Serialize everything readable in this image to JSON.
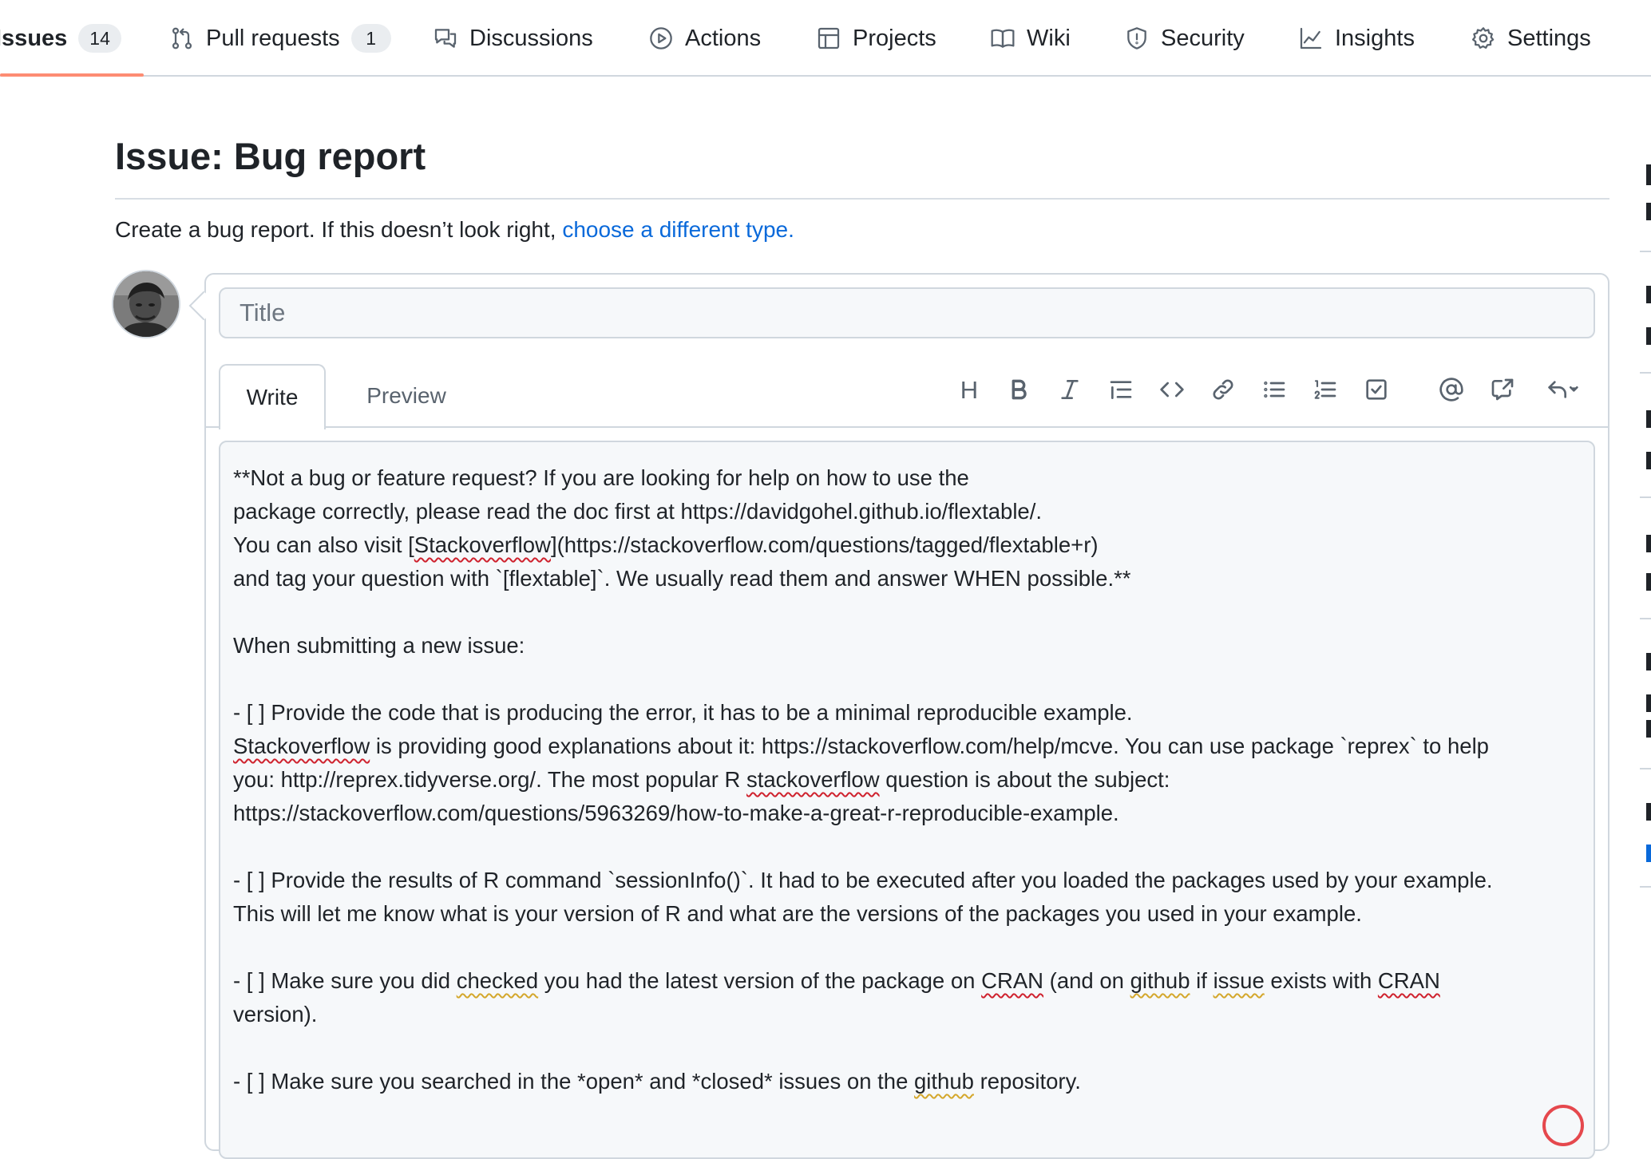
{
  "repo_nav": [
    {
      "label": "Issues",
      "count": "14",
      "icon": "issue-icon",
      "selected": true
    },
    {
      "label": "Pull requests",
      "count": "1",
      "icon": "pull-request-icon"
    },
    {
      "label": "Discussions",
      "icon": "comment-discussion-icon"
    },
    {
      "label": "Actions",
      "icon": "play-icon"
    },
    {
      "label": "Projects",
      "icon": "table-icon"
    },
    {
      "label": "Wiki",
      "icon": "book-icon"
    },
    {
      "label": "Security",
      "icon": "shield-icon"
    },
    {
      "label": "Insights",
      "icon": "graph-icon"
    },
    {
      "label": "Settings",
      "icon": "gear-icon"
    }
  ],
  "page": {
    "title": "Issue: Bug report",
    "subtitle_text": "Create a bug report. If this doesn’t look right,",
    "subtitle_link": "choose a different type."
  },
  "form": {
    "title_placeholder": "Title",
    "tabs": {
      "write": "Write",
      "preview": "Preview"
    },
    "toolbar": [
      {
        "name": "heading-button",
        "label": "H"
      },
      {
        "name": "bold-button",
        "icon": "bold-icon"
      },
      {
        "name": "italic-button",
        "icon": "italic-icon"
      },
      {
        "name": "quote-button",
        "icon": "quote-icon"
      },
      {
        "name": "code-button",
        "icon": "code-icon"
      },
      {
        "name": "link-button",
        "icon": "link-icon"
      },
      {
        "name": "unordered-list-button",
        "icon": "list-unordered-icon"
      },
      {
        "name": "ordered-list-button",
        "icon": "list-ordered-icon"
      },
      {
        "name": "task-list-button",
        "icon": "tasklist-icon"
      },
      {
        "name": "mention-button",
        "icon": "mention-icon"
      },
      {
        "name": "cross-reference-button",
        "icon": "cross-reference-icon"
      },
      {
        "name": "saved-replies-button",
        "icon": "reply-icon"
      }
    ],
    "body_lines": [
      "**Not a bug or feature request? If you are looking for help on how to use the",
      "package correctly, please read the doc first at https://davidgohel.github.io/flextable/.",
      "You can also visit [Stackoverflow](https://stackoverflow.com/questions/tagged/flextable+r)",
      "and tag your question with `[flextable]`. We usually read them and answer WHEN possible.**",
      "",
      "When submitting a new issue:",
      "",
      "- [ ] Provide the code that is producing the error, it has to be a minimal reproducible example.",
      "Stackoverflow is providing good explanations about it: https://stackoverflow.com/help/mcve. You can use package `reprex` to help",
      "you: http://reprex.tidyverse.org/. The most popular R stackoverflow question is about the subject:",
      "https://stackoverflow.com/questions/5963269/how-to-make-a-great-r-reproducible-example.",
      "",
      "- [ ] Provide the results of R command `sessionInfo()`. It had to be executed after you loaded the packages used by your example.",
      "This will let me know what is your version of R and what are the versions of the packages you used in your example.",
      "",
      "- [ ] Make sure you did checked you had the latest version of the package on CRAN (and on github if issue exists with CRAN",
      "version).",
      "",
      "- [ ] Make sure you searched in the *open* and *closed* issues on the github repository."
    ]
  },
  "colors": {
    "accent_link": "#0969da",
    "nav_underline": "#fd8c73",
    "spell_error": "#cf222e",
    "grammar_warning": "#d4a72c"
  }
}
